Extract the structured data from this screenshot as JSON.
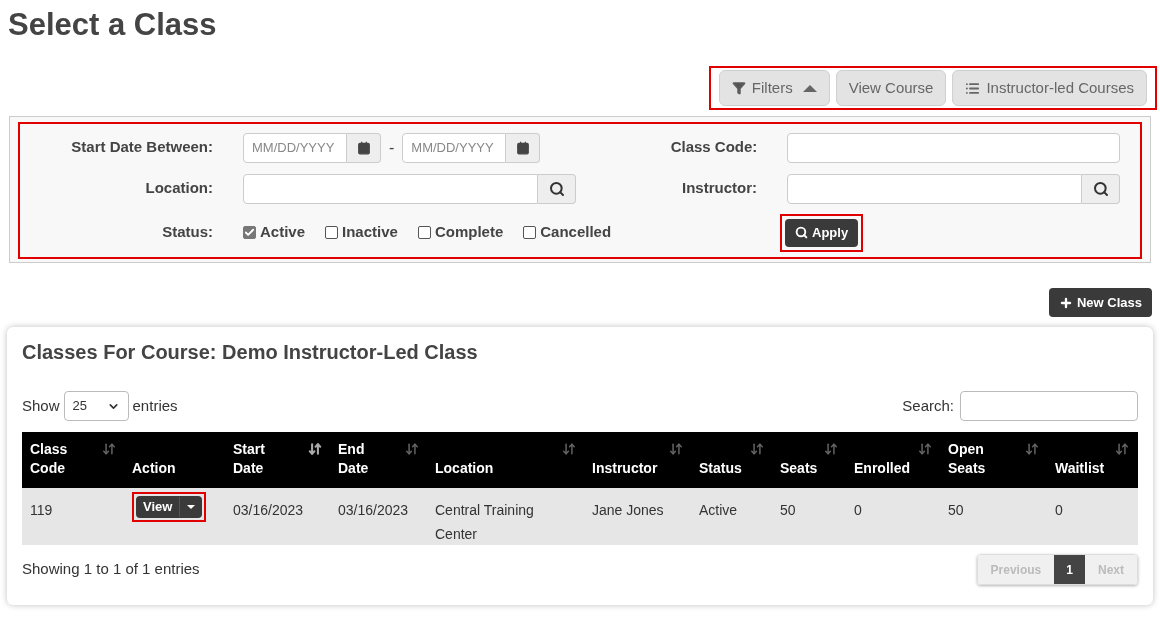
{
  "page_title": "Select a Class",
  "toolbar": {
    "highlighted": true,
    "buttons": [
      {
        "kind": "filters",
        "label": "Filters"
      },
      {
        "kind": "plain",
        "label": "View Course"
      },
      {
        "kind": "list",
        "label": "Instructor-led Courses"
      }
    ]
  },
  "filters": {
    "highlighted": true,
    "start_date": {
      "label": "Start Date Between:",
      "from_placeholder": "MM/DD/YYYY",
      "separator": "-",
      "to_placeholder": "MM/DD/YYYY"
    },
    "class_code": {
      "label": "Class Code:"
    },
    "location": {
      "label": "Location:"
    },
    "instructor": {
      "label": "Instructor:"
    },
    "status": {
      "label": "Status:",
      "options": [
        {
          "label": "Active",
          "checked": true
        },
        {
          "label": "Inactive",
          "checked": false
        },
        {
          "label": "Complete",
          "checked": false
        },
        {
          "label": "Cancelled",
          "checked": false
        }
      ]
    },
    "apply": {
      "label": "Apply",
      "highlighted": true
    }
  },
  "new_class_button": "New Class",
  "card": {
    "title": "Classes For Course: Demo Instructor-Led Class",
    "show": {
      "before": "Show",
      "value": "25",
      "after": "entries"
    },
    "search_label": "Search:",
    "table": {
      "columns": [
        {
          "label": "Class Code",
          "sorted": false
        },
        {
          "label": "Action",
          "sortable": false
        },
        {
          "label": "Start Date",
          "sorted": true
        },
        {
          "label": "End Date",
          "sorted": false
        },
        {
          "label": "Location",
          "sorted": false
        },
        {
          "label": "Instructor",
          "sorted": false
        },
        {
          "label": "Status",
          "sorted": false
        },
        {
          "label": "Seats",
          "sorted": false
        },
        {
          "label": "Enrolled",
          "sorted": false
        },
        {
          "label": "Open Seats",
          "sorted": false
        },
        {
          "label": "Waitlist",
          "sorted": false
        }
      ],
      "rows": [
        {
          "cells": [
            "119",
            {
              "action": "View",
              "highlighted": true
            },
            "03/16/2023",
            "03/16/2023",
            "Central Training Center",
            "Jane Jones",
            "Active",
            "50",
            "0",
            "50",
            "0"
          ]
        }
      ]
    },
    "info": "Showing 1 to 1 of 1 entries",
    "pagination": [
      {
        "label": "Previous",
        "kind": "nav",
        "disabled": true,
        "selected": false
      },
      {
        "label": "1",
        "kind": "page",
        "disabled": false,
        "selected": true
      },
      {
        "label": "Next",
        "kind": "nav",
        "disabled": true,
        "selected": false
      }
    ]
  }
}
